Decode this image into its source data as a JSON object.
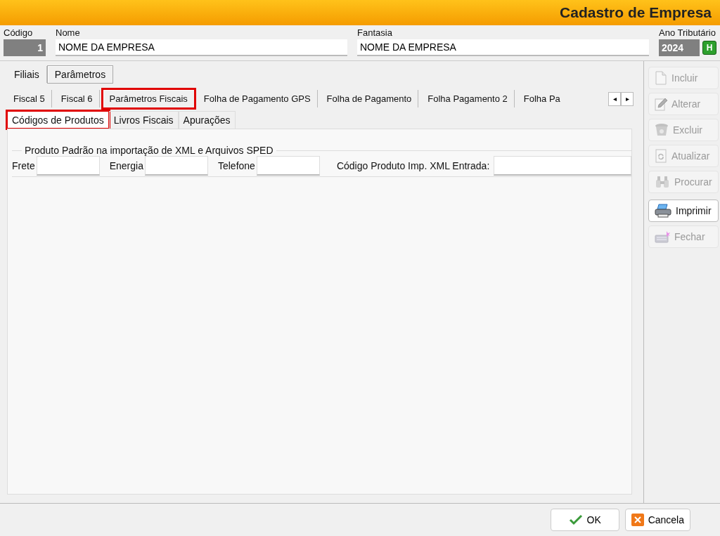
{
  "window": {
    "title": "Cadastro de Empresa"
  },
  "header_fields": [
    {
      "label": "Código",
      "value": "1",
      "kind": "code"
    },
    {
      "label": "Nome",
      "value": "NOME DA EMPRESA",
      "kind": "text"
    },
    {
      "label": "Fantasia",
      "value": "NOME DA EMPRESA",
      "kind": "text"
    },
    {
      "label": "Ano Tributário",
      "value": "2024",
      "kind": "year",
      "button": "H"
    }
  ],
  "main_tabs": [
    {
      "label": "Filiais",
      "selected": false
    },
    {
      "label": "Parâmetros",
      "selected": true
    }
  ],
  "param_tabs": [
    {
      "label": "Fiscal 5",
      "selected": false,
      "highlighted": false
    },
    {
      "label": "Fiscal 6",
      "selected": false,
      "highlighted": false
    },
    {
      "label": "Parâmetros Fiscais",
      "selected": true,
      "highlighted": true
    },
    {
      "label": "Folha de Pagamento GPS",
      "selected": false,
      "highlighted": false
    },
    {
      "label": "Folha de Pagamento",
      "selected": false,
      "highlighted": false
    },
    {
      "label": "Folha Pagamento 2",
      "selected": false,
      "highlighted": false
    },
    {
      "label": "Folha Pa",
      "selected": false,
      "highlighted": false
    }
  ],
  "tab_scroll": [
    "◂",
    "▸"
  ],
  "sub_tabs": [
    {
      "label": "Códigos de Produtos",
      "selected": true,
      "highlighted": true
    },
    {
      "label": "Livros Fiscais",
      "selected": false,
      "highlighted": false
    },
    {
      "label": "Apurações",
      "selected": false,
      "highlighted": false
    }
  ],
  "group": {
    "title": "Produto Padrão na importação  de XML e Arquivos SPED",
    "fields": [
      {
        "label": "Frete"
      },
      {
        "label": "Energia"
      },
      {
        "label": "Telefone"
      },
      {
        "label": "Código Produto Imp. XML Entrada:"
      }
    ]
  },
  "side_buttons": [
    {
      "label": "Incluir",
      "kind": "new",
      "disabled": true
    },
    {
      "label": "Alterar",
      "kind": "edit",
      "disabled": true
    },
    {
      "label": "Excluir",
      "kind": "delete",
      "disabled": true
    },
    {
      "label": "Atualizar",
      "kind": "refresh",
      "disabled": true
    },
    {
      "label": "Procurar",
      "kind": "search",
      "disabled": true
    },
    {
      "label": "Imprimir",
      "kind": "print",
      "disabled": false
    },
    {
      "label": "Fechar",
      "kind": "close",
      "disabled": true
    }
  ],
  "footer_buttons": [
    {
      "label": "OK",
      "kind": "ok"
    },
    {
      "label": "Cancela",
      "kind": "cancel"
    }
  ]
}
